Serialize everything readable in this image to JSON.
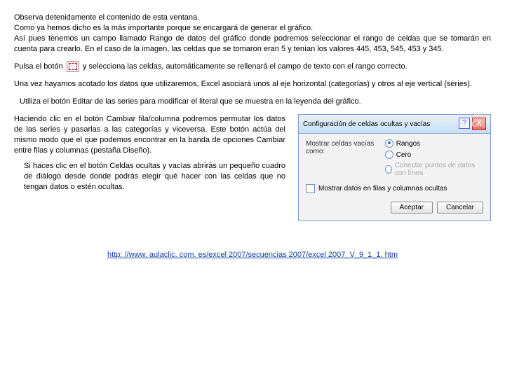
{
  "paragraphs": {
    "p1": "Observa detenidamente el contenido de esta ventana.",
    "p2": "Como ya hemos dicho es la más importante porque se encargará de generar el gráfico.",
    "p3": "Así pues tenemos un campo llamado Rango de datos del gráfico donde podremos seleccionar el rango de celdas que se tomarán en cuenta para crearlo. En el caso de la imagen, las celdas que se tomaron eran 5 y tenían los valores 445, 453, 545, 453 y 345.",
    "p4_pre": "Pulsa el botón",
    "p4_post": " y selecciona las celdas, automáticamente se rellenará el campo de texto con el rango correcto.",
    "p5": "Una vez hayamos acotado los datos que utilizaremos, Excel asociará unos al eje horizontal (categorías) y otros al eje vertical (series).",
    "p6": "Utiliza el botón Editar de las series para modificar el literal que se muestra en la leyenda del gráfico.",
    "left_main": "Haciendo clic en el botón Cambiar fila/columna podremos permutar los datos de las series y pasarlas a las categorías y viceversa. Este botón actúa del mismo modo que el que podemos encontrar en la banda de opciones Cambiar entre filas y columnas (pestaña Diseño).",
    "left_sub": "Si haces clic en el botón Celdas ocultas y vacías abrirás un pequeño cuadro de diálogo desde donde podrás elegir qué hacer con las celdas que no tengan datos o estén ocultas."
  },
  "dialog": {
    "title": "Configuración de celdas ocultas y vacías",
    "help_icon": "?",
    "close_icon": "X",
    "show_empty_as": "Mostrar celdas vacías como:",
    "opt_rangos": "Rangos",
    "opt_cero": "Cero",
    "opt_connect": "Conectar puntos de datos con línea",
    "chk_show_hidden": "Mostrar datos en filas y columnas ocultas",
    "btn_accept": "Aceptar",
    "btn_cancel": "Cancelar"
  },
  "watermark": {
    "a": "aula",
    "b": "Clic"
  },
  "footer": {
    "url": "http: //www. aulaclic. com. es/excel 2007/secuencias 2007/excel 2007_V_9_1_1. htm"
  }
}
